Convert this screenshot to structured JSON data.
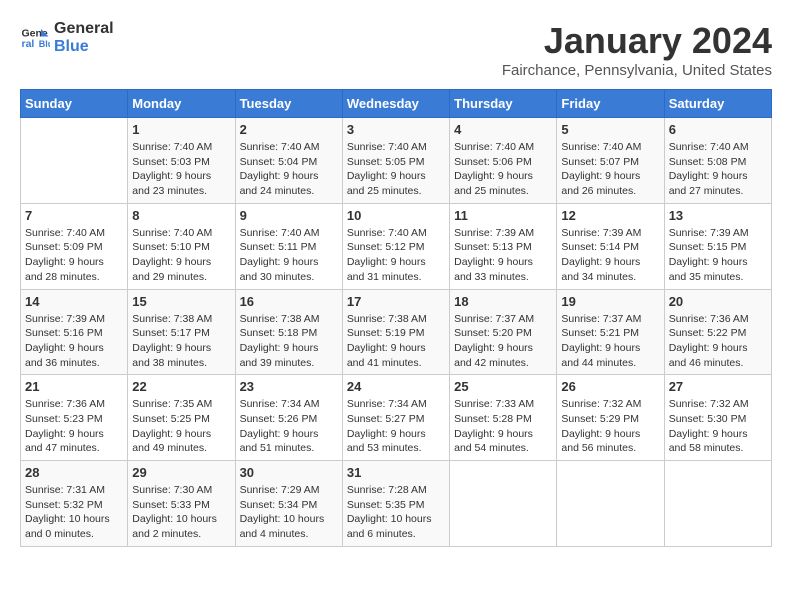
{
  "logo": {
    "line1": "General",
    "line2": "Blue"
  },
  "title": "January 2024",
  "location": "Fairchance, Pennsylvania, United States",
  "header": {
    "days": [
      "Sunday",
      "Monday",
      "Tuesday",
      "Wednesday",
      "Thursday",
      "Friday",
      "Saturday"
    ]
  },
  "weeks": [
    [
      {
        "day": "",
        "sunrise": "",
        "sunset": "",
        "daylight": ""
      },
      {
        "day": "1",
        "sunrise": "Sunrise: 7:40 AM",
        "sunset": "Sunset: 5:03 PM",
        "daylight": "Daylight: 9 hours and 23 minutes."
      },
      {
        "day": "2",
        "sunrise": "Sunrise: 7:40 AM",
        "sunset": "Sunset: 5:04 PM",
        "daylight": "Daylight: 9 hours and 24 minutes."
      },
      {
        "day": "3",
        "sunrise": "Sunrise: 7:40 AM",
        "sunset": "Sunset: 5:05 PM",
        "daylight": "Daylight: 9 hours and 25 minutes."
      },
      {
        "day": "4",
        "sunrise": "Sunrise: 7:40 AM",
        "sunset": "Sunset: 5:06 PM",
        "daylight": "Daylight: 9 hours and 25 minutes."
      },
      {
        "day": "5",
        "sunrise": "Sunrise: 7:40 AM",
        "sunset": "Sunset: 5:07 PM",
        "daylight": "Daylight: 9 hours and 26 minutes."
      },
      {
        "day": "6",
        "sunrise": "Sunrise: 7:40 AM",
        "sunset": "Sunset: 5:08 PM",
        "daylight": "Daylight: 9 hours and 27 minutes."
      }
    ],
    [
      {
        "day": "7",
        "sunrise": "Sunrise: 7:40 AM",
        "sunset": "Sunset: 5:09 PM",
        "daylight": "Daylight: 9 hours and 28 minutes."
      },
      {
        "day": "8",
        "sunrise": "Sunrise: 7:40 AM",
        "sunset": "Sunset: 5:10 PM",
        "daylight": "Daylight: 9 hours and 29 minutes."
      },
      {
        "day": "9",
        "sunrise": "Sunrise: 7:40 AM",
        "sunset": "Sunset: 5:11 PM",
        "daylight": "Daylight: 9 hours and 30 minutes."
      },
      {
        "day": "10",
        "sunrise": "Sunrise: 7:40 AM",
        "sunset": "Sunset: 5:12 PM",
        "daylight": "Daylight: 9 hours and 31 minutes."
      },
      {
        "day": "11",
        "sunrise": "Sunrise: 7:39 AM",
        "sunset": "Sunset: 5:13 PM",
        "daylight": "Daylight: 9 hours and 33 minutes."
      },
      {
        "day": "12",
        "sunrise": "Sunrise: 7:39 AM",
        "sunset": "Sunset: 5:14 PM",
        "daylight": "Daylight: 9 hours and 34 minutes."
      },
      {
        "day": "13",
        "sunrise": "Sunrise: 7:39 AM",
        "sunset": "Sunset: 5:15 PM",
        "daylight": "Daylight: 9 hours and 35 minutes."
      }
    ],
    [
      {
        "day": "14",
        "sunrise": "Sunrise: 7:39 AM",
        "sunset": "Sunset: 5:16 PM",
        "daylight": "Daylight: 9 hours and 36 minutes."
      },
      {
        "day": "15",
        "sunrise": "Sunrise: 7:38 AM",
        "sunset": "Sunset: 5:17 PM",
        "daylight": "Daylight: 9 hours and 38 minutes."
      },
      {
        "day": "16",
        "sunrise": "Sunrise: 7:38 AM",
        "sunset": "Sunset: 5:18 PM",
        "daylight": "Daylight: 9 hours and 39 minutes."
      },
      {
        "day": "17",
        "sunrise": "Sunrise: 7:38 AM",
        "sunset": "Sunset: 5:19 PM",
        "daylight": "Daylight: 9 hours and 41 minutes."
      },
      {
        "day": "18",
        "sunrise": "Sunrise: 7:37 AM",
        "sunset": "Sunset: 5:20 PM",
        "daylight": "Daylight: 9 hours and 42 minutes."
      },
      {
        "day": "19",
        "sunrise": "Sunrise: 7:37 AM",
        "sunset": "Sunset: 5:21 PM",
        "daylight": "Daylight: 9 hours and 44 minutes."
      },
      {
        "day": "20",
        "sunrise": "Sunrise: 7:36 AM",
        "sunset": "Sunset: 5:22 PM",
        "daylight": "Daylight: 9 hours and 46 minutes."
      }
    ],
    [
      {
        "day": "21",
        "sunrise": "Sunrise: 7:36 AM",
        "sunset": "Sunset: 5:23 PM",
        "daylight": "Daylight: 9 hours and 47 minutes."
      },
      {
        "day": "22",
        "sunrise": "Sunrise: 7:35 AM",
        "sunset": "Sunset: 5:25 PM",
        "daylight": "Daylight: 9 hours and 49 minutes."
      },
      {
        "day": "23",
        "sunrise": "Sunrise: 7:34 AM",
        "sunset": "Sunset: 5:26 PM",
        "daylight": "Daylight: 9 hours and 51 minutes."
      },
      {
        "day": "24",
        "sunrise": "Sunrise: 7:34 AM",
        "sunset": "Sunset: 5:27 PM",
        "daylight": "Daylight: 9 hours and 53 minutes."
      },
      {
        "day": "25",
        "sunrise": "Sunrise: 7:33 AM",
        "sunset": "Sunset: 5:28 PM",
        "daylight": "Daylight: 9 hours and 54 minutes."
      },
      {
        "day": "26",
        "sunrise": "Sunrise: 7:32 AM",
        "sunset": "Sunset: 5:29 PM",
        "daylight": "Daylight: 9 hours and 56 minutes."
      },
      {
        "day": "27",
        "sunrise": "Sunrise: 7:32 AM",
        "sunset": "Sunset: 5:30 PM",
        "daylight": "Daylight: 9 hours and 58 minutes."
      }
    ],
    [
      {
        "day": "28",
        "sunrise": "Sunrise: 7:31 AM",
        "sunset": "Sunset: 5:32 PM",
        "daylight": "Daylight: 10 hours and 0 minutes."
      },
      {
        "day": "29",
        "sunrise": "Sunrise: 7:30 AM",
        "sunset": "Sunset: 5:33 PM",
        "daylight": "Daylight: 10 hours and 2 minutes."
      },
      {
        "day": "30",
        "sunrise": "Sunrise: 7:29 AM",
        "sunset": "Sunset: 5:34 PM",
        "daylight": "Daylight: 10 hours and 4 minutes."
      },
      {
        "day": "31",
        "sunrise": "Sunrise: 7:28 AM",
        "sunset": "Sunset: 5:35 PM",
        "daylight": "Daylight: 10 hours and 6 minutes."
      },
      {
        "day": "",
        "sunrise": "",
        "sunset": "",
        "daylight": ""
      },
      {
        "day": "",
        "sunrise": "",
        "sunset": "",
        "daylight": ""
      },
      {
        "day": "",
        "sunrise": "",
        "sunset": "",
        "daylight": ""
      }
    ]
  ]
}
